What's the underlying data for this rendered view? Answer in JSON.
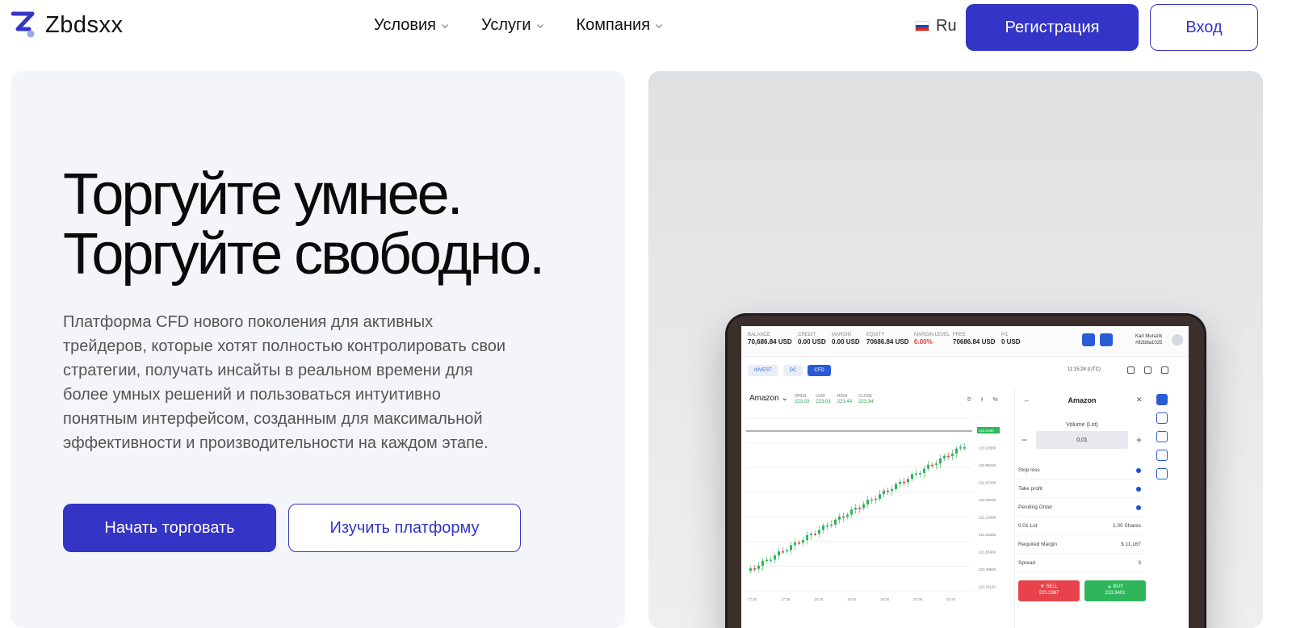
{
  "brand": {
    "name": "Zbdsxx",
    "accent": "#3434c6"
  },
  "nav": {
    "items": [
      {
        "label": "Условия"
      },
      {
        "label": "Услуги"
      },
      {
        "label": "Компания"
      }
    ]
  },
  "lang": {
    "label": "Ru"
  },
  "auth": {
    "register_label": "Регистрация",
    "login_label": "Вход"
  },
  "hero": {
    "headline_line1": "Торгуйте умнее.",
    "headline_line2": "Торгуйте свободно.",
    "description": "Платформа CFD нового поколения для активных трейдеров, которые хотят полностью контролировать свои стратегии, получать инсайты в реальном времени для более умных решений и пользоваться интуитивно понятным интерфейсом, созданным для максимальной эффективности и производительности на каждом этапе.",
    "start_label": "Начать торговать",
    "learn_label": "Изучить платформу"
  },
  "terminal": {
    "stats": [
      {
        "label": "BALANCE",
        "value": "70,686.84 USD"
      },
      {
        "label": "CREDIT",
        "value": "0.00 USD"
      },
      {
        "label": "MARGIN",
        "value": "0.00 USD"
      },
      {
        "label": "EQUITY",
        "value": "70686.84 USD"
      },
      {
        "label": "MARGIN LEVEL",
        "value": "0.00%"
      },
      {
        "label": "FREE",
        "value": "70686.84 USD"
      },
      {
        "label": "P/L",
        "value": "0 USD"
      }
    ],
    "user_name": "Karl Murazik",
    "user_id": "#82b8a1025",
    "tabs": [
      "INVEST",
      "DC",
      "CFD"
    ],
    "time": "11:15:24 (UTC)",
    "symbol": "Amazon",
    "ohlc": [
      {
        "label": "OPEN",
        "value": "223.03"
      },
      {
        "label": "LOW",
        "value": "223.03"
      },
      {
        "label": "HIGH",
        "value": "223.44"
      },
      {
        "label": "CLOSE",
        "value": "223.34"
      }
    ],
    "chart_toolbar": [
      "5'",
      "⫲",
      "%"
    ],
    "price_labels": [
      "223.3400",
      "223.22880",
      "222.95160",
      "222.67440",
      "222.39720",
      "222.12000",
      "221.84280",
      "221.56560",
      "221.28840",
      "221.01120"
    ],
    "time_labels": [
      "17:00\n13.01.2025",
      "17:35",
      "18:25",
      "19:00",
      "19:35",
      "20:00",
      "20:45"
    ],
    "panel": {
      "title": "Amazon",
      "volume_label": "Volume (Lot)",
      "volume_value": "0,01",
      "rows": [
        {
          "label": "Stop loss",
          "value": ""
        },
        {
          "label": "Take profit",
          "value": ""
        },
        {
          "label": "Pending Order",
          "value": ""
        },
        {
          "label": "0.01 Lot",
          "value": "1.00 Shares"
        },
        {
          "label": "Required Margin",
          "value": "$ 11,167"
        },
        {
          "label": "Spread",
          "value": "3"
        }
      ],
      "sell_label": "▼ SELL",
      "sell_price": "223.3387",
      "buy_label": "▲ BUY",
      "buy_price": "223.3401"
    }
  }
}
